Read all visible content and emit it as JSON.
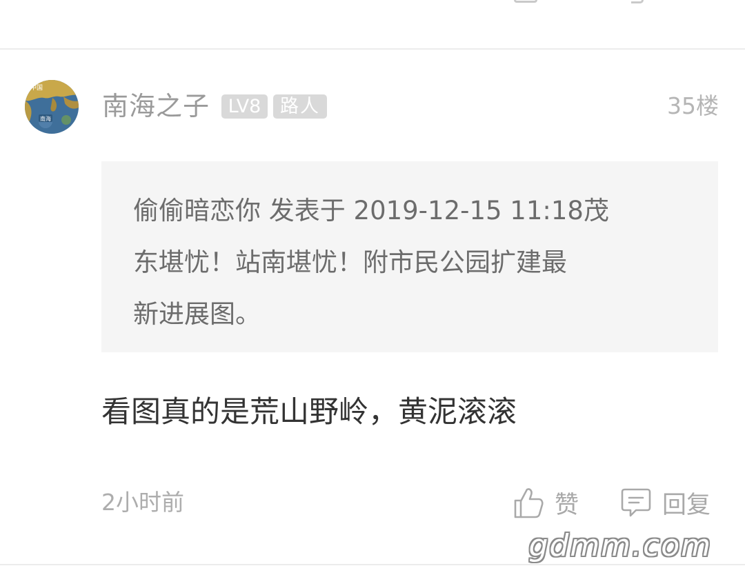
{
  "post": {
    "author": {
      "name": "南海之子",
      "level_badge": "LV8",
      "title_badge": "路人",
      "avatar": {
        "icon": "map-avatar-icon",
        "map_labels": [
          "中国",
          "南海"
        ]
      }
    },
    "floor": "35楼",
    "quote": {
      "text": "偷偷暗恋你 发表于 2019-12-15 11:18茂\n东堪忧！站南堪忧！附市民公园扩建最\n新进展图。"
    },
    "content": "看图真的是荒山野岭，黄泥滚滚",
    "time": "2小时前",
    "actions": {
      "like": {
        "label": "赞",
        "icon": "thumbs-up-icon"
      },
      "reply": {
        "label": "回复",
        "icon": "comment-icon"
      }
    }
  },
  "watermark": "gdmm.com",
  "colors": {
    "background": "#ffffff",
    "quote_background": "#f5f5f5",
    "badge_background": "#d9d9d9",
    "muted_text": "#9a9a9a",
    "body_text": "#333333"
  }
}
